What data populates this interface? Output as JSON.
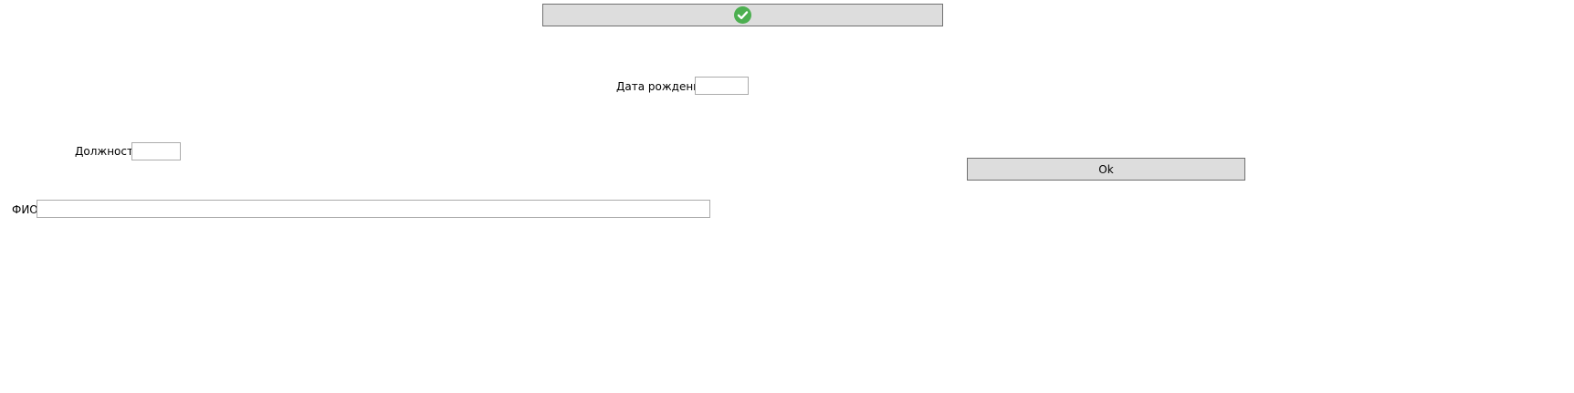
{
  "top_button": {
    "icon": "check-circle-icon",
    "icon_color": "#4caf50"
  },
  "birth_date": {
    "label": "Дата рождения",
    "value": "",
    "placeholder": ""
  },
  "position": {
    "label": "Должность",
    "value": "",
    "placeholder": ""
  },
  "full_name": {
    "label": "ФИО",
    "value": "",
    "placeholder": ""
  },
  "ok_button": {
    "label": "Ok"
  }
}
